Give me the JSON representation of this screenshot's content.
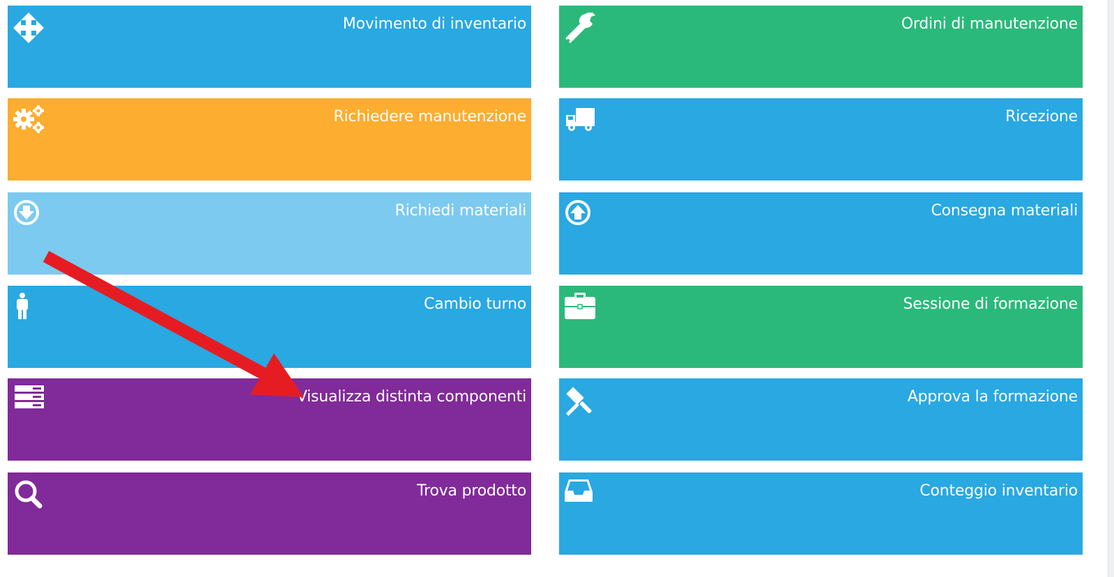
{
  "colors": {
    "blue": "#29a8e2",
    "green": "#2bb97b",
    "orange": "#fdad2f",
    "light_blue": "#7ccaef",
    "purple": "#812a99",
    "arrow_red": "#e51d23"
  },
  "tiles_left": [
    {
      "label": "Movimento di inventario",
      "color": "#29a8e2",
      "icon": "move-arrows-icon"
    },
    {
      "label": "Richiedere manutenzione",
      "color": "#fdad2f",
      "icon": "gears-icon"
    },
    {
      "label": "Richiedi materiali",
      "color": "#7ccaef",
      "icon": "download-circle-icon"
    },
    {
      "label": "Cambio turno",
      "color": "#29a8e2",
      "icon": "person-icon"
    },
    {
      "label": "Visualizza distinta componenti",
      "color": "#812a99",
      "icon": "server-list-icon"
    },
    {
      "label": "Trova prodotto",
      "color": "#812a99",
      "icon": "search-icon"
    }
  ],
  "tiles_right": [
    {
      "label": "Ordini di manutenzione",
      "color": "#2bb97b",
      "icon": "wrench-icon"
    },
    {
      "label": "Ricezione",
      "color": "#29a8e2",
      "icon": "truck-icon"
    },
    {
      "label": "Consegna materiali",
      "color": "#29a8e2",
      "icon": "upload-circle-icon"
    },
    {
      "label": "Sessione di formazione",
      "color": "#2bb97b",
      "icon": "briefcase-icon"
    },
    {
      "label": "Approva la formazione",
      "color": "#29a8e2",
      "icon": "gavel-icon"
    },
    {
      "label": "Conteggio inventario",
      "color": "#29a8e2",
      "icon": "inbox-tray-icon"
    }
  ]
}
